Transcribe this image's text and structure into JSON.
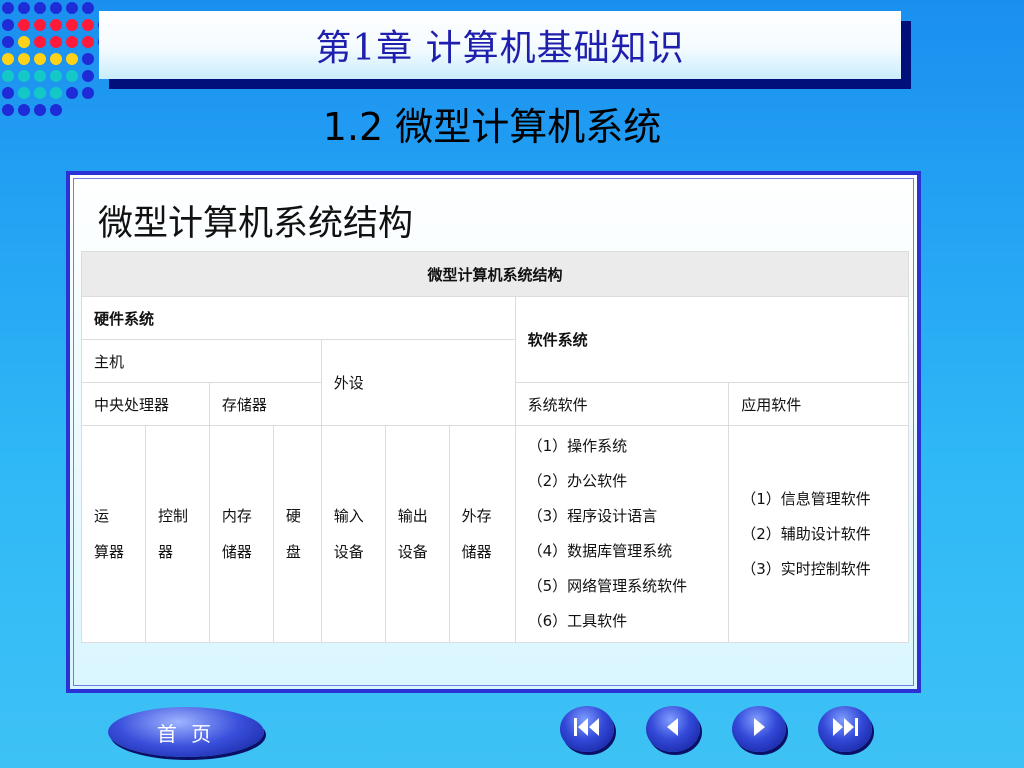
{
  "header": {
    "chapter_title": "第1章  计算机基础知识",
    "section_title": "1.2  微型计算机系统"
  },
  "panel": {
    "heading": "微型计算机系统结构"
  },
  "table": {
    "caption": "微型计算机系统结构",
    "hardware": "硬件系统",
    "software": "软件系统",
    "host": "主机",
    "peripherals": "外设",
    "cpu": "中央处理器",
    "storage": "存储器",
    "system_software": "系统软件",
    "application_software": "应用软件",
    "alu": [
      "运",
      "算器"
    ],
    "controller": [
      "控制",
      "器"
    ],
    "memory": [
      "内存",
      "储器"
    ],
    "hdd": [
      "硬",
      "盘"
    ],
    "input": [
      "输入",
      "设备"
    ],
    "output": [
      "输出",
      "设备"
    ],
    "external_storage": [
      "外存",
      "储器"
    ],
    "system_software_items": [
      "（1）操作系统",
      "（2）办公软件",
      "（3）程序设计语言",
      "（4）数据库管理系统",
      "（5）网络管理系统软件",
      "（6）工具软件"
    ],
    "application_software_items": [
      "（1）信息管理软件",
      "（2）辅助设计软件",
      "（3）实时控制软件"
    ]
  },
  "footer": {
    "home_label": "首 页",
    "nav_icons": [
      "first-page-icon",
      "previous-page-icon",
      "next-page-icon",
      "last-page-icon"
    ]
  },
  "colors": {
    "title_text": "#1f1fae",
    "panel_border": "#2a32d6",
    "background": "#2fb8f6"
  }
}
